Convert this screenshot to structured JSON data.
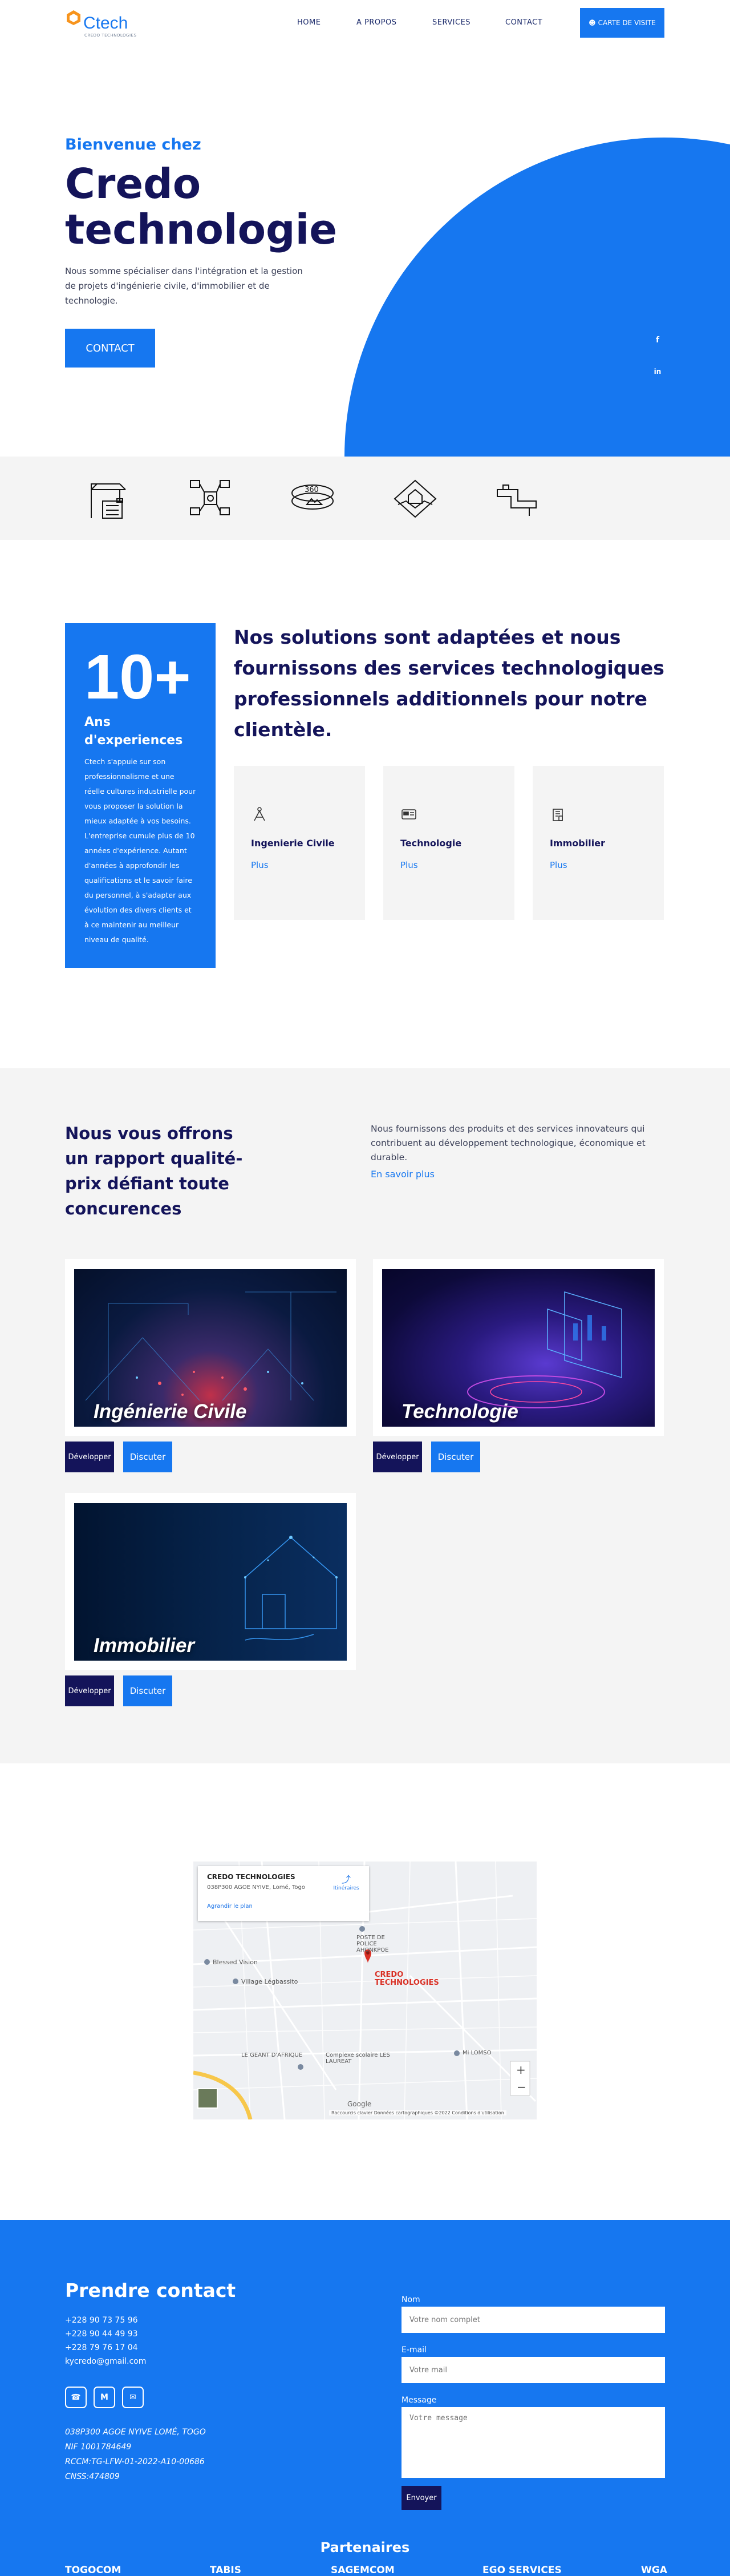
{
  "header": {
    "logo_text": "Ctech",
    "logo_sub": "CREDO TECHNOLOGIES",
    "nav": [
      "HOME",
      "A PROPOS",
      "SERVICES",
      "CONTACT"
    ],
    "cta": "CARTE DE VISITE"
  },
  "hero": {
    "subtitle": "Bienvenue chez",
    "title_line1": "Credo",
    "title_line2": "technologie",
    "description": "Nous somme spécialiser dans l'intégration et la gestion de projets d'ingénierie civile, d'immobilier et de technologie.",
    "button": "CONTACT",
    "social": [
      "facebook-icon",
      "linkedin-icon"
    ]
  },
  "icon_band": [
    "construction-icon",
    "network-icon",
    "360-view-icon",
    "handshake-house-icon",
    "plumbing-icon"
  ],
  "experience": {
    "number": "10+",
    "label": "Ans d'experiences",
    "text": "Ctech s'appuie sur son professionnalisme et une réelle cultures industrielle pour vous proposer la solution la mieux adaptée à vos besoins. L'entreprise cumule plus de 10 années d'expérience. Autant d'années à approfondir les qualifications et le savoir faire du personnel, à s'adapter aux évolution des divers clients et à ce maintenir au meilleur niveau de qualité.",
    "solutions_title": "Nos solutions sont adaptées et nous fournissons des services technologiques professionnels additionnels pour notre clientèle.",
    "cards": [
      {
        "title": "Ingenierie Civile",
        "link": "Plus",
        "icon": "civil-engineering-icon"
      },
      {
        "title": "Technologie",
        "link": "Plus",
        "icon": "technology-icon"
      },
      {
        "title": "Immobilier",
        "link": "Plus",
        "icon": "real-estate-icon"
      }
    ]
  },
  "offer": {
    "title": "Nous vous offrons un rapport qualité-prix défiant toute concurences",
    "description": "Nous fournissons des produits et des services innovateurs qui contribuent au développement technologique, économique et durable.",
    "link": "En savoir plus",
    "services": [
      {
        "name": "Ingénierie Civile",
        "btn1": "Développer",
        "btn2": "Discuter"
      },
      {
        "name": "Technologie",
        "btn1": "Développer",
        "btn2": "Discuter"
      },
      {
        "name": "Immobilier",
        "btn1": "Développer",
        "btn2": "Discuter"
      }
    ]
  },
  "map": {
    "place": "CREDO TECHNOLOGIES",
    "address": "038P300 AGOE NYIVE, Lomé, Togo",
    "directions": "Itinéraires",
    "enlarge": "Agrandir le plan",
    "pin_label_1": "CREDO",
    "pin_label_2": "TECHNOLOGIES",
    "labels": [
      "POSTE DE POLICE AHONKPOE",
      "Blessed Vision",
      "Village Légbassito",
      "LE GEANT D'AFRIQUE",
      "Complexe scolaire LES LAUREAT",
      "Mi LOMSO"
    ],
    "attribution": "Raccourcis clavier  Données cartographiques ©2022  Conditions d'utilisation",
    "google": "Google"
  },
  "contact": {
    "title": "Prendre contact",
    "phones": [
      "+228 90 73 75 96",
      "+228 90 44 49 93",
      "+228 79 76 17 04"
    ],
    "email": "kycredo@gmail.com",
    "social": [
      "whatsapp-icon",
      "gmail-icon",
      "messenger-icon"
    ],
    "legal": [
      "038P300 AGOE NYIVE LOMÉ, TOGO",
      "NIF 1001784649",
      "RCCM:TG-LFW-01-2022-A10-00686",
      "CNSS:474809"
    ],
    "form": {
      "name_label": "Nom",
      "name_placeholder": "Votre nom complet",
      "email_label": "E-mail",
      "email_placeholder": "Votre mail",
      "message_label": "Message",
      "message_placeholder": "Votre message",
      "submit": "Envoyer"
    },
    "partners_title": "Partenaires",
    "partners": [
      "TOGOCOM",
      "TABIS",
      "SAGEMCOM",
      "EGO SERVICES",
      "WGA"
    ]
  },
  "colors": {
    "primary": "#1677f0",
    "dark": "#14145a",
    "light_bg": "#f4f4f4"
  }
}
